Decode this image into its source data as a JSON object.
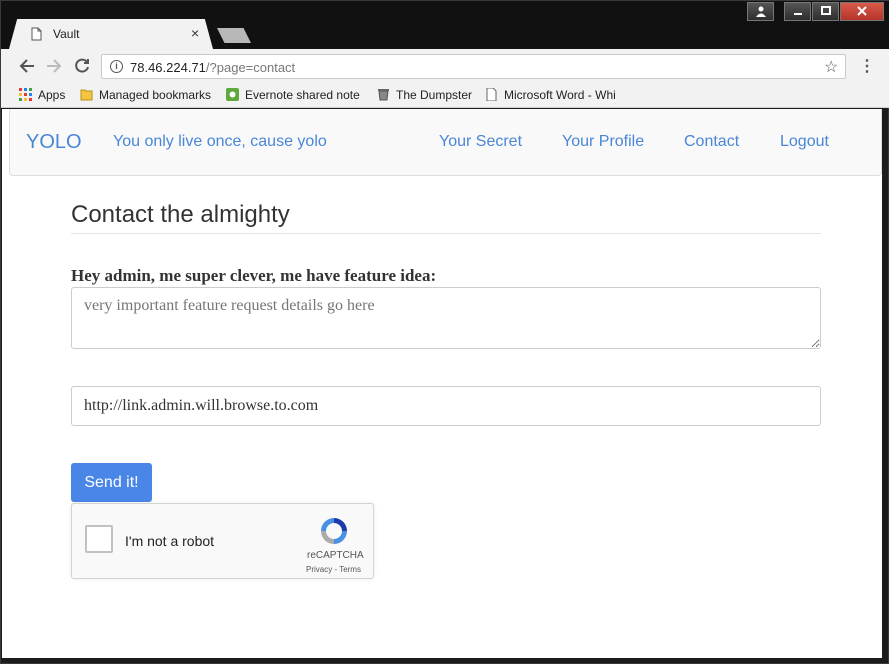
{
  "browser": {
    "tab_title": "Vault",
    "tab_close": "×",
    "url_host": "78.46.224.71",
    "url_path": "/?page=contact",
    "icons": {
      "back": "back-arrow-icon",
      "forward": "forward-arrow-icon",
      "reload": "reload-icon",
      "info": "info-icon",
      "star": "star-icon",
      "menu": "kebab-menu-icon"
    },
    "bookmarks": [
      {
        "label": "Apps"
      },
      {
        "label": "Managed bookmarks"
      },
      {
        "label": "Evernote shared note"
      },
      {
        "label": "The Dumpster"
      },
      {
        "label": "Microsoft Word - Whi"
      }
    ]
  },
  "navbar": {
    "brand": "YOLO",
    "tagline": "You only live once, cause yolo",
    "links": [
      "Your Secret",
      "Your Profile",
      "Contact",
      "Logout"
    ]
  },
  "form": {
    "heading": "Contact the almighty",
    "label": "Hey admin, me super clever, me have feature idea:",
    "textarea_placeholder": "very important feature request details go here",
    "url_value": "http://link.admin.will.browse.to.com",
    "submit_label": "Send it!"
  },
  "captcha": {
    "label": "I'm not a robot",
    "brand": "reCAPTCHA",
    "links": "Privacy - Terms"
  },
  "colors": {
    "link": "#4a86d8",
    "button": "#4a86e8"
  }
}
